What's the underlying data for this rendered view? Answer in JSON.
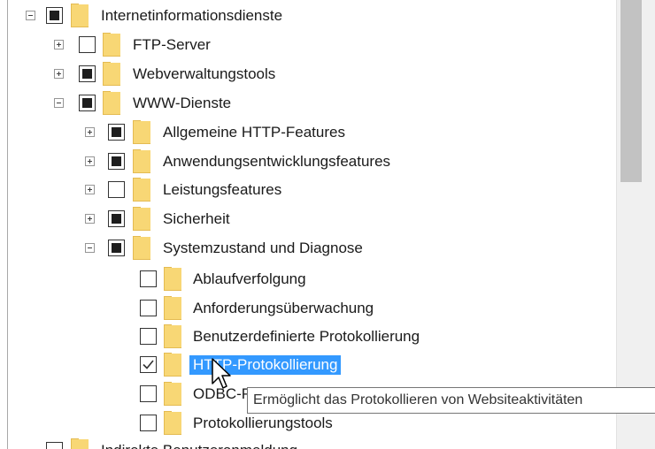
{
  "tree": {
    "items": [
      {
        "label": "Internetinformationsdienste",
        "state": "partial",
        "expander": "minus"
      },
      {
        "label": "FTP-Server",
        "state": "unchecked",
        "expander": "plus"
      },
      {
        "label": "Webverwaltungstools",
        "state": "partial",
        "expander": "plus"
      },
      {
        "label": "WWW-Dienste",
        "state": "partial",
        "expander": "minus"
      },
      {
        "label": "Allgemeine HTTP-Features",
        "state": "partial",
        "expander": "plus"
      },
      {
        "label": "Anwendungsentwicklungsfeatures",
        "state": "partial",
        "expander": "plus"
      },
      {
        "label": "Leistungsfeatures",
        "state": "unchecked",
        "expander": "plus"
      },
      {
        "label": "Sicherheit",
        "state": "partial",
        "expander": "plus"
      },
      {
        "label": "Systemzustand und Diagnose",
        "state": "partial",
        "expander": "minus"
      },
      {
        "label": "Ablaufverfolgung",
        "state": "unchecked"
      },
      {
        "label": "Anforderungsüberwachung",
        "state": "unchecked"
      },
      {
        "label": "Benutzerdefinierte Protokollierung",
        "state": "unchecked"
      },
      {
        "label": "HTTP-Protokollierung",
        "state": "checked",
        "selected": true
      },
      {
        "label": "ODBC-Protokollierung",
        "state": "unchecked"
      },
      {
        "label": "Protokollierungstools",
        "state": "unchecked"
      },
      {
        "label": "Indirekte Benutzeranmeldung",
        "state": "unchecked"
      }
    ]
  },
  "tooltip": {
    "text": "Ermöglicht das Protokollieren von Websiteaktivitäten"
  },
  "colors": {
    "selection": "#3399ff",
    "folder": "#f8d775",
    "scroll_thumb": "#c2c2c2"
  }
}
